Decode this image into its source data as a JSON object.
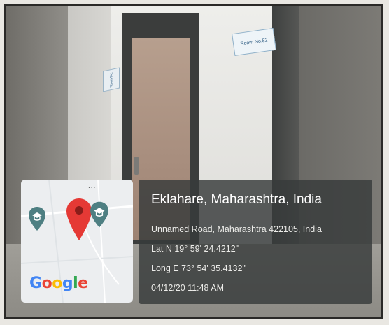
{
  "photo": {
    "room_sign_text": "Room No.82",
    "side_sign_text": "Room No."
  },
  "map": {
    "menu_dots": "...",
    "pins": [
      "school-pin-icon",
      "location-pin-icon",
      "school-pin-icon"
    ],
    "logo_letters": [
      "G",
      "o",
      "o",
      "g",
      "l",
      "e"
    ],
    "logo_colors": [
      "#4285F4",
      "#EA4335",
      "#FBBC05",
      "#4285F4",
      "#34A853",
      "#EA4335"
    ],
    "pin_color": "#E53935",
    "school_pin_color": "#4E7F82"
  },
  "info": {
    "place": "Eklahare, Maharashtra, India",
    "address": "Unnamed Road, Maharashtra 422105, India",
    "latitude": "Lat N 19° 59' 24.4212\"",
    "longitude": "Long E 73° 54' 35.4132\"",
    "timestamp": "04/12/20 11:48 AM"
  }
}
